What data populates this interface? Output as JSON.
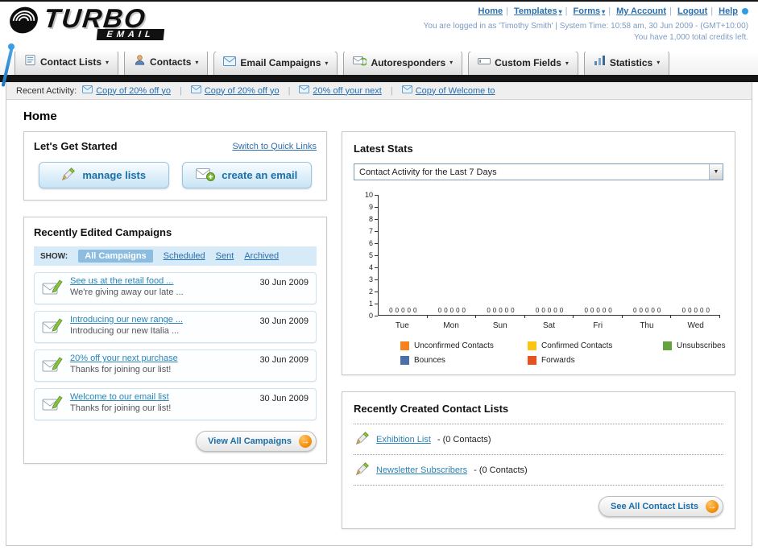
{
  "brand": {
    "name_top": "TURBO",
    "name_bottom": "EMAIL"
  },
  "header": {
    "links": [
      {
        "label": "Home",
        "dropdown": false
      },
      {
        "label": "Templates",
        "dropdown": true
      },
      {
        "label": "Forms",
        "dropdown": true
      },
      {
        "label": "My Account",
        "dropdown": false
      },
      {
        "label": "Logout",
        "dropdown": false
      },
      {
        "label": "Help",
        "dropdown": false
      }
    ],
    "login_line": "You are logged in as 'Timothy Smith' | System Time: 10:58 am, 30 Jun 2009 - (GMT+10:00)",
    "credits_line": "You have 1,000 total credits left."
  },
  "nav": {
    "tabs": [
      {
        "label": "Contact Lists",
        "icon": "contact-lists-icon"
      },
      {
        "label": "Contacts",
        "icon": "contacts-icon"
      },
      {
        "label": "Email Campaigns",
        "icon": "email-campaigns-icon"
      },
      {
        "label": "Autoresponders",
        "icon": "autoresponders-icon"
      },
      {
        "label": "Custom Fields",
        "icon": "custom-fields-icon"
      },
      {
        "label": "Statistics",
        "icon": "statistics-icon"
      }
    ]
  },
  "activity": {
    "label": "Recent Activity:",
    "items": [
      "Copy of 20% off yo",
      "Copy of 20% off yo",
      "20% off your next",
      "Copy of Welcome to"
    ]
  },
  "page": {
    "title": "Home"
  },
  "get_started": {
    "title": "Let's Get Started",
    "switch_link": "Switch to Quick Links",
    "manage_lists_label": "manage lists",
    "create_email_label": "create an email"
  },
  "campaigns": {
    "title": "Recently Edited Campaigns",
    "show_label": "SHOW:",
    "filters": [
      "All Campaigns",
      "Scheduled",
      "Sent",
      "Archived"
    ],
    "active_filter": "All Campaigns",
    "items": [
      {
        "title": "See us at the retail food ...",
        "subtitle": "We're giving away our late ...",
        "date": "30 Jun 2009"
      },
      {
        "title": "Introducing our new range ...",
        "subtitle": "Introducing our new Italia ...",
        "date": "30 Jun 2009"
      },
      {
        "title": "20% off your next purchase",
        "subtitle": "Thanks for joining our list!",
        "date": "30 Jun 2009"
      },
      {
        "title": "Welcome to our email list",
        "subtitle": "Thanks for joining our list!",
        "date": "30 Jun 2009"
      }
    ],
    "view_all_label": "View All Campaigns"
  },
  "stats": {
    "title": "Latest Stats",
    "period_selected": "Contact Activity for the Last 7 Days"
  },
  "chart_data": {
    "type": "bar",
    "title": "Contact Activity for the Last 7 Days",
    "categories": [
      "Tue",
      "Mon",
      "Sun",
      "Sat",
      "Fri",
      "Thu",
      "Wed"
    ],
    "series": [
      {
        "name": "Unconfirmed Contacts",
        "color": "#f5821f",
        "values": [
          0,
          0,
          0,
          0,
          0,
          0,
          0
        ]
      },
      {
        "name": "Confirmed Contacts",
        "color": "#fdc511",
        "values": [
          0,
          0,
          0,
          0,
          0,
          0,
          0
        ]
      },
      {
        "name": "Unsubscribes",
        "color": "#61a53c",
        "values": [
          0,
          0,
          0,
          0,
          0,
          0,
          0
        ]
      },
      {
        "name": "Bounces",
        "color": "#4d6fa8",
        "values": [
          0,
          0,
          0,
          0,
          0,
          0,
          0
        ]
      },
      {
        "name": "Forwards",
        "color": "#e65321",
        "values": [
          0,
          0,
          0,
          0,
          0,
          0,
          0
        ]
      }
    ],
    "ylim": [
      0,
      10
    ],
    "ytick_step": 1,
    "grid": false,
    "legend_position": "bottom"
  },
  "contact_lists": {
    "title": "Recently Created Contact Lists",
    "items": [
      {
        "name": "Exhibition List",
        "detail": "- (0 Contacts)"
      },
      {
        "name": "Newsletter Subscribers",
        "detail": "- (0 Contacts)"
      }
    ],
    "see_all_label": "See All Contact Lists"
  },
  "colors": {
    "link": "#2a6fb0",
    "accent_orange": "#f08a00"
  }
}
